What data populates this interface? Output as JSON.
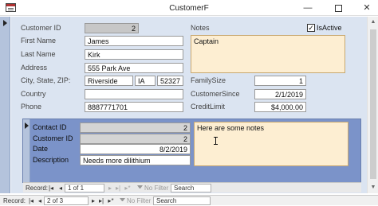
{
  "window": {
    "title": "CustomerF",
    "minimize_icon": "minimize-icon",
    "maximize_icon": "maximize-icon",
    "close_icon": "close-icon",
    "close_glyph": "✕",
    "minimize_glyph": "—"
  },
  "form": {
    "customer_id": {
      "label": "Customer ID",
      "value": "2"
    },
    "first_name": {
      "label": "First Name",
      "value": "James"
    },
    "last_name": {
      "label": "Last Name",
      "value": "Kirk"
    },
    "address": {
      "label": "Address",
      "value": "555 Park Ave"
    },
    "city_state_zip": {
      "label": "City, State, ZIP:",
      "city": "Riverside",
      "state": "IA",
      "zip": "52327"
    },
    "country": {
      "label": "Country",
      "value": ""
    },
    "phone": {
      "label": "Phone",
      "value": "8887771701"
    },
    "notes": {
      "label": "Notes",
      "value": "Captain"
    },
    "is_active": {
      "label": "IsActive",
      "checked": true,
      "glyph": "✓"
    },
    "family_size": {
      "label": "FamilySize",
      "value": "1"
    },
    "customer_since": {
      "label": "CustomerSince",
      "value": "2/1/2019"
    },
    "credit_limit": {
      "label": "CreditLimit",
      "value": "$4,000.00"
    }
  },
  "subform": {
    "contact_id": {
      "label": "Contact ID",
      "value": "2"
    },
    "customer_id": {
      "label": "Customer ID",
      "value": "2"
    },
    "date": {
      "label": "Date",
      "value": "8/2/2019"
    },
    "description": {
      "label": "Description",
      "value": "Needs more dilithium"
    },
    "notes": {
      "value": "Here are some notes"
    }
  },
  "subform_nav": {
    "record_label": "Record:",
    "first_glyph": "|◂",
    "prev_glyph": "◂",
    "position": "1 of 1",
    "next_glyph": "▸",
    "last_glyph": "▸|",
    "new_glyph": "▸*",
    "filter_label": "No Filter",
    "search_label": "Search"
  },
  "main_nav": {
    "record_label": "Record:",
    "first_glyph": "|◂",
    "prev_glyph": "◂",
    "position": "2 of 3",
    "next_glyph": "▸",
    "last_glyph": "▸|",
    "new_glyph": "▸*",
    "filter_label": "No Filter",
    "search_label": "Search"
  }
}
